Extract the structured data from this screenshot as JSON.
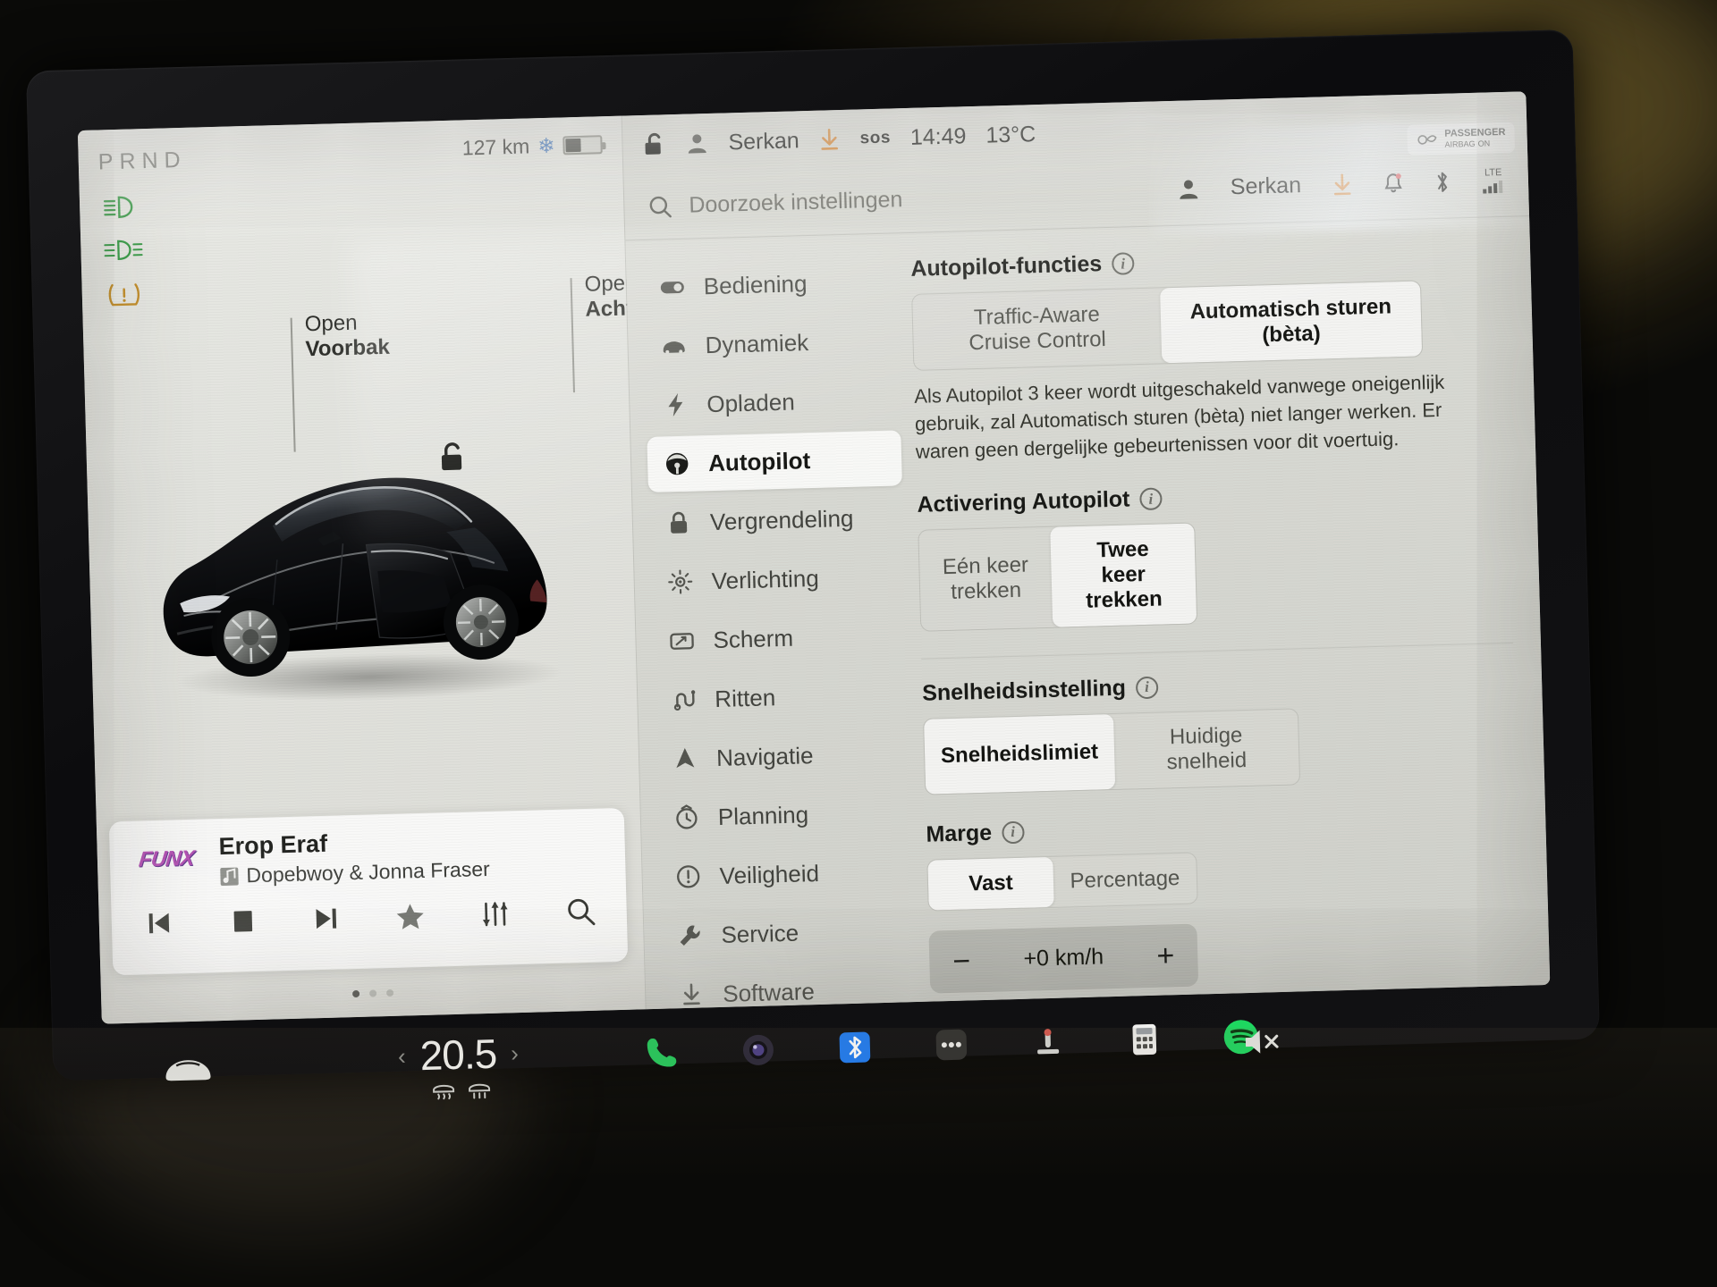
{
  "vehicle_display": {
    "gear_indicator": "PRND",
    "gear_selected": "P",
    "range": "127 km",
    "battery_percent_visual": 42,
    "telltales": [
      "low-beam-headlight",
      "front-fog-light",
      "tire-pressure-warning"
    ],
    "callouts": [
      {
        "line1": "Open",
        "line2": "Voorbak"
      },
      {
        "line1": "Open",
        "line2": "Achterbak"
      }
    ],
    "lock_state": "unlocked"
  },
  "media": {
    "station": "FUNX",
    "track_title": "Erop Eraf",
    "artist": "Dopebwoy & Jonna Fraser",
    "controls": [
      "previous-track",
      "stop",
      "next-track",
      "favorite",
      "equalizer",
      "search"
    ],
    "page_dots": 3,
    "page_active": 0
  },
  "status_bar": {
    "lock_icon": "unlocked-padlock-icon",
    "driver": "Serkan",
    "download_icon": "download-arrow-icon",
    "sos": "sos",
    "clock": "14:49",
    "temperature": "13°C"
  },
  "airbag_indicator": {
    "title": "PASSENGER",
    "subtitle": "AIRBAG",
    "state": "ON"
  },
  "search": {
    "placeholder": "Doorzoek instellingen"
  },
  "account_bar": {
    "name": "Serkan",
    "icons": [
      "download-arrow-icon",
      "bell-icon",
      "bluetooth-icon",
      "cellular-signal-icon"
    ],
    "network_label": "LTE"
  },
  "settings_nav": {
    "items": [
      {
        "label": "Bediening",
        "icon": "toggle-switch-icon",
        "selected": false
      },
      {
        "label": "Dynamiek",
        "icon": "car-front-icon",
        "selected": false
      },
      {
        "label": "Opladen",
        "icon": "lightning-bolt-icon",
        "selected": false
      },
      {
        "label": "Autopilot",
        "icon": "steering-wheel-icon",
        "selected": true
      },
      {
        "label": "Vergrendeling",
        "icon": "padlock-icon",
        "selected": false
      },
      {
        "label": "Verlichting",
        "icon": "sun-brightness-icon",
        "selected": false
      },
      {
        "label": "Scherm",
        "icon": "display-screen-icon",
        "selected": false
      },
      {
        "label": "Ritten",
        "icon": "route-path-icon",
        "selected": false
      },
      {
        "label": "Navigatie",
        "icon": "navigation-arrow-icon",
        "selected": false
      },
      {
        "label": "Planning",
        "icon": "schedule-clock-icon",
        "selected": false
      },
      {
        "label": "Veiligheid",
        "icon": "alert-circle-icon",
        "selected": false
      },
      {
        "label": "Service",
        "icon": "wrench-icon",
        "selected": false
      },
      {
        "label": "Software",
        "icon": "download-arrow-icon",
        "selected": false
      }
    ]
  },
  "autopilot": {
    "features": {
      "title": "Autopilot-functies",
      "option_1": "Traffic-Aware\nCruise Control",
      "option_1_line1": "Traffic-Aware",
      "option_1_line2": "Cruise Control",
      "option_2": "Automatisch sturen (bèta)",
      "selected": "Automatisch sturen (bèta)",
      "description": "Als Autopilot 3 keer wordt uitgeschakeld vanwege oneigenlijk gebruik, zal Automatisch sturen (bèta) niet langer werken. Er waren geen dergelijke gebeurtenissen voor dit voertuig."
    },
    "activation": {
      "title": "Activering Autopilot",
      "option_1_line1": "Eén keer",
      "option_1_line2": "trekken",
      "option_2_line1": "Twee keer",
      "option_2_line2": "trekken",
      "selected": "Twee keer trekken"
    },
    "speed_setting": {
      "title": "Snelheidsinstelling",
      "option_1": "Snelheidslimiet",
      "option_2": "Huidige snelheid",
      "selected": "Snelheidslimiet"
    },
    "margin": {
      "title": "Marge",
      "option_1": "Vast",
      "option_2": "Percentage",
      "selected": "Vast",
      "value": "+0 km/h",
      "decrease": "−",
      "increase": "+"
    }
  },
  "dock": {
    "car_icon": "car-front-icon",
    "temperature": "20.5",
    "prev_arrow": "‹",
    "next_arrow": "›",
    "defrost": [
      "front-defrost-icon",
      "rear-defrost-icon"
    ],
    "apps": [
      "phone-icon",
      "camera-icon",
      "bluetooth-icon",
      "more-dots-icon",
      "seat-heater-icon",
      "calculator-icon",
      "spotify-icon"
    ],
    "mute": "mute-speaker-icon"
  },
  "colors": {
    "accent_green": "#2ab45c",
    "bluetooth_blue": "#1f7cf2",
    "spotify_green": "#1ed760",
    "telltale_green": "#3f9e4d",
    "telltale_amber": "#c3902f",
    "screen_bg": "#dcddd7"
  }
}
